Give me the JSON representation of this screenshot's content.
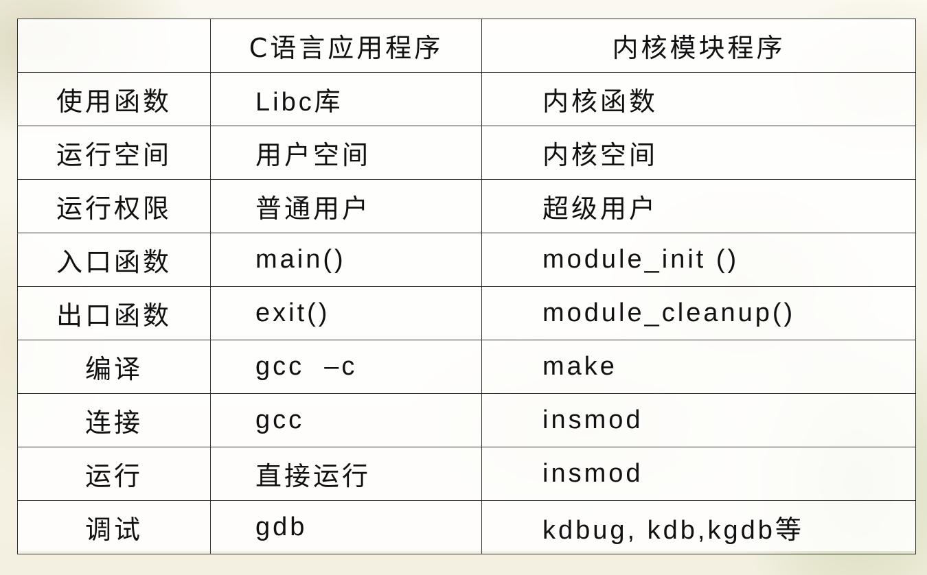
{
  "table": {
    "headers": [
      "",
      "C语言应用程序",
      "内核模块程序"
    ],
    "rows": [
      {
        "label": "使用函数",
        "c_app": "Libc库",
        "kernel": "内核函数"
      },
      {
        "label": "运行空间",
        "c_app": "用户空间",
        "kernel": "内核空间"
      },
      {
        "label": "运行权限",
        "c_app": "普通用户",
        "kernel": "超级用户"
      },
      {
        "label": "入口函数",
        "c_app": "main()",
        "kernel": "module_init ()"
      },
      {
        "label": "出口函数",
        "c_app": "exit()",
        "kernel": "module_cleanup()"
      },
      {
        "label": "编译",
        "c_app": "gcc  –c",
        "kernel": "make"
      },
      {
        "label": "连接",
        "c_app": "gcc",
        "kernel": "insmod"
      },
      {
        "label": "运行",
        "c_app": "直接运行",
        "kernel": "insmod"
      },
      {
        "label": "调试",
        "c_app": "gdb",
        "kernel": "kdbug, kdb,kgdb等"
      }
    ]
  }
}
